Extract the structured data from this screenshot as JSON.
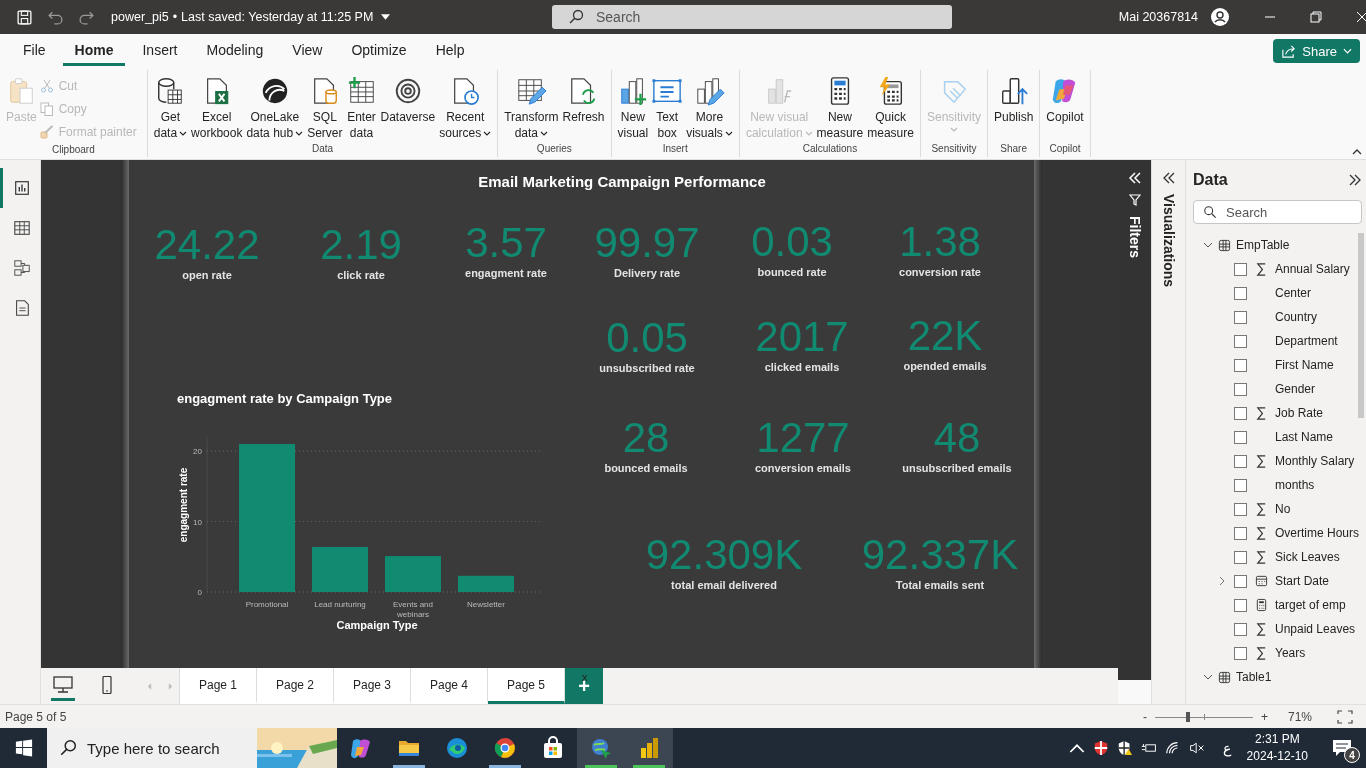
{
  "title_bar": {
    "file_name": "power_pi5",
    "separator": "•",
    "saved": "Last saved: Yesterday at 11:25 PM",
    "search": {
      "placeholder": "Search"
    },
    "user": "Mai 20367814"
  },
  "menu_tabs": [
    {
      "label": "File",
      "selected": false
    },
    {
      "label": "Home",
      "selected": true
    },
    {
      "label": "Insert",
      "selected": false
    },
    {
      "label": "Modeling",
      "selected": false
    },
    {
      "label": "View",
      "selected": false
    },
    {
      "label": "Optimize",
      "selected": false
    },
    {
      "label": "Help",
      "selected": false
    }
  ],
  "share_button": "Share",
  "ribbon": [
    {
      "label": "Clipboard",
      "items": [
        {
          "kind": "large",
          "lines": [
            "Paste"
          ],
          "disabled": true,
          "dropdown": false
        },
        {
          "kind": "small",
          "lines": [
            "Cut"
          ],
          "disabled": true,
          "dropdown": false
        },
        {
          "kind": "small",
          "lines": [
            "Copy"
          ],
          "disabled": true,
          "dropdown": false
        },
        {
          "kind": "small",
          "lines": [
            "Format painter"
          ],
          "disabled": true,
          "dropdown": false
        }
      ]
    },
    {
      "label": "Data",
      "items": [
        {
          "kind": "large",
          "lines": [
            "Get",
            "data"
          ],
          "disabled": false,
          "dropdown": true
        },
        {
          "kind": "large",
          "lines": [
            "Excel",
            "workbook"
          ],
          "disabled": false,
          "dropdown": false
        },
        {
          "kind": "large",
          "lines": [
            "OneLake",
            "data hub"
          ],
          "disabled": false,
          "dropdown": true
        },
        {
          "kind": "large",
          "lines": [
            "SQL",
            "Server"
          ],
          "disabled": false,
          "dropdown": false
        },
        {
          "kind": "large",
          "lines": [
            "Enter",
            "data"
          ],
          "disabled": false,
          "dropdown": false
        },
        {
          "kind": "large",
          "lines": [
            "Dataverse"
          ],
          "disabled": false,
          "dropdown": false
        },
        {
          "kind": "large",
          "lines": [
            "Recent",
            "sources"
          ],
          "disabled": false,
          "dropdown": true
        }
      ]
    },
    {
      "label": "Queries",
      "items": [
        {
          "kind": "large",
          "lines": [
            "Transform",
            "data"
          ],
          "disabled": false,
          "dropdown": true
        },
        {
          "kind": "large",
          "lines": [
            "Refresh"
          ],
          "disabled": false,
          "dropdown": false
        }
      ]
    },
    {
      "label": "Insert",
      "items": [
        {
          "kind": "large",
          "lines": [
            "New",
            "visual"
          ],
          "disabled": false,
          "dropdown": false
        },
        {
          "kind": "large",
          "lines": [
            "Text",
            "box"
          ],
          "disabled": false,
          "dropdown": false
        },
        {
          "kind": "large",
          "lines": [
            "More",
            "visuals"
          ],
          "disabled": false,
          "dropdown": true
        }
      ]
    },
    {
      "label": "Calculations",
      "items": [
        {
          "kind": "large",
          "lines": [
            "New visual",
            "calculation"
          ],
          "disabled": true,
          "dropdown": true
        },
        {
          "kind": "large",
          "lines": [
            "New",
            "measure"
          ],
          "disabled": false,
          "dropdown": false
        },
        {
          "kind": "large",
          "lines": [
            "Quick",
            "measure"
          ],
          "disabled": false,
          "dropdown": false
        }
      ]
    },
    {
      "label": "Sensitivity",
      "items": [
        {
          "kind": "large",
          "lines": [
            "Sensitivity"
          ],
          "disabled": true,
          "dropdown": true
        }
      ]
    },
    {
      "label": "Share",
      "items": [
        {
          "kind": "large",
          "lines": [
            "Publish"
          ],
          "disabled": false,
          "dropdown": false
        }
      ]
    },
    {
      "label": "Copilot",
      "items": [
        {
          "kind": "large",
          "lines": [
            "Copilot"
          ],
          "disabled": false,
          "dropdown": false
        }
      ]
    }
  ],
  "view_rail": [
    {
      "selected": true
    },
    {
      "selected": false
    },
    {
      "selected": false
    },
    {
      "selected": false
    }
  ],
  "report": {
    "title": "Email Marketing Campaign Performance",
    "cards": [
      {
        "value": "24.22",
        "label": "open rate"
      },
      {
        "value": "2.19",
        "label": "click rate"
      },
      {
        "value": "3.57",
        "label": "engagment rate"
      },
      {
        "value": "99.97",
        "label": "Delivery rate"
      },
      {
        "value": "0.03",
        "label": "bounced rate"
      },
      {
        "value": "1.38",
        "label": "conversion rate"
      },
      {
        "value": "0.05",
        "label": "unsubscribed rate"
      },
      {
        "value": "2017",
        "label": "clicked emails"
      },
      {
        "value": "22K",
        "label": "opended emails"
      },
      {
        "value": "28",
        "label": "bounced emails"
      },
      {
        "value": "1277",
        "label": "conversion emails"
      },
      {
        "value": "48",
        "label": "unsubscribed emails"
      },
      {
        "value": "92.309K",
        "label": "total email delivered"
      },
      {
        "value": "92.337K",
        "label": "Total emails sent"
      }
    ],
    "chart": {
      "chart_data": {
        "type": "bar",
        "title": "engagment rate by Campaign Type",
        "xlabel": "Campaign Type",
        "ylabel": "engagment rate",
        "categories": [
          "Promotional",
          "Lead nurturing",
          "Events and webinars",
          "Newsletter"
        ],
        "values": [
          21.0,
          6.4,
          5.1,
          2.3
        ],
        "ylim": [
          0,
          22
        ],
        "yticks": [
          0,
          10,
          20
        ]
      }
    }
  },
  "filters_pane": {
    "label": "Filters"
  },
  "visualizations_pane": {
    "label": "Visualizations"
  },
  "data_pane": {
    "title": "Data",
    "search": {
      "placeholder": "Search"
    },
    "tables": [
      {
        "name": "EmpTable",
        "expanded": true,
        "children": [
          {
            "name": "Annual Salary",
            "kind": "sum",
            "checked": false,
            "expandable": false
          },
          {
            "name": "Center",
            "kind": "text",
            "checked": false,
            "expandable": false
          },
          {
            "name": "Country",
            "kind": "text",
            "checked": false,
            "expandable": false
          },
          {
            "name": "Department",
            "kind": "text",
            "checked": false,
            "expandable": false
          },
          {
            "name": "First Name",
            "kind": "text",
            "checked": false,
            "expandable": false
          },
          {
            "name": "Gender",
            "kind": "text",
            "checked": false,
            "expandable": false
          },
          {
            "name": "Job Rate",
            "kind": "sum",
            "checked": false,
            "expandable": false
          },
          {
            "name": "Last Name",
            "kind": "text",
            "checked": false,
            "expandable": false
          },
          {
            "name": "Monthly Salary",
            "kind": "sum",
            "checked": false,
            "expandable": false
          },
          {
            "name": "months",
            "kind": "text",
            "checked": false,
            "expandable": false
          },
          {
            "name": "No",
            "kind": "sum",
            "checked": false,
            "expandable": false
          },
          {
            "name": "Overtime Hours",
            "kind": "sum",
            "checked": false,
            "expandable": false
          },
          {
            "name": "Sick Leaves",
            "kind": "sum",
            "checked": false,
            "expandable": false
          },
          {
            "name": "Start Date",
            "kind": "date",
            "checked": false,
            "expandable": true
          },
          {
            "name": "target of emp",
            "kind": "measure",
            "checked": false,
            "expandable": false
          },
          {
            "name": "Unpaid Leaves",
            "kind": "sum",
            "checked": false,
            "expandable": false
          },
          {
            "name": "Years",
            "kind": "sum",
            "checked": false,
            "expandable": false
          }
        ]
      },
      {
        "name": "Table1",
        "expanded": true
      }
    ]
  },
  "page_tabs": {
    "views": [
      {
        "selected": true
      },
      {
        "selected": false
      }
    ],
    "pages": [
      {
        "label": "Page 1",
        "selected": false
      },
      {
        "label": "Page 2",
        "selected": false
      },
      {
        "label": "Page 3",
        "selected": false
      },
      {
        "label": "Page 4",
        "selected": false
      },
      {
        "label": "Page 5",
        "selected": true
      }
    ],
    "close": "x",
    "add": "+"
  },
  "status_bar": {
    "page": "Page 5 of 5",
    "zoom": {
      "minus": "-",
      "plus": "+",
      "level": 0.34,
      "reading": "71%"
    }
  },
  "taskbar": {
    "search": {
      "placeholder": "Type here to search"
    },
    "apps": [
      {
        "running": false,
        "active": false
      },
      {
        "running": true,
        "active": false
      },
      {
        "running": false,
        "active": false
      },
      {
        "running": true,
        "active": false
      },
      {
        "running": false,
        "active": false
      },
      {
        "running": true,
        "active": true
      },
      {
        "running": true,
        "active": true
      }
    ],
    "language": "ع",
    "time": "2:31 PM",
    "date": "2024-12-10",
    "notifications": "4"
  }
}
